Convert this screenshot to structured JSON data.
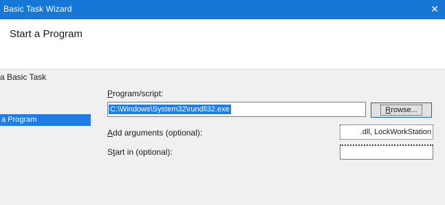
{
  "window": {
    "title": "Basic Task Wizard",
    "close_glyph": "✕"
  },
  "header": {
    "heading": "Start a Program"
  },
  "sidebar": {
    "title": "a Basic Task",
    "items": [
      {
        "label": "a Program",
        "selected": true
      }
    ]
  },
  "form": {
    "program_label_accel": "P",
    "program_label_rest": "rogram/script:",
    "program_value": "C:\\Windows\\System32\\rundll32.exe",
    "browse_label_accel": "R",
    "browse_label_rest": "rowse...",
    "args_label_accel": "A",
    "args_label_rest": "dd arguments (optional):",
    "args_value": ".dll, LockWorkStation",
    "start_label_pre": "S",
    "start_label_accel": "t",
    "start_label_rest": "art in (optional):",
    "start_value": ""
  },
  "colors": {
    "titlebar": "#1777d6",
    "selection": "#1f7de8",
    "panel": "#f0f0f0",
    "header_bg": "#ffffff"
  }
}
